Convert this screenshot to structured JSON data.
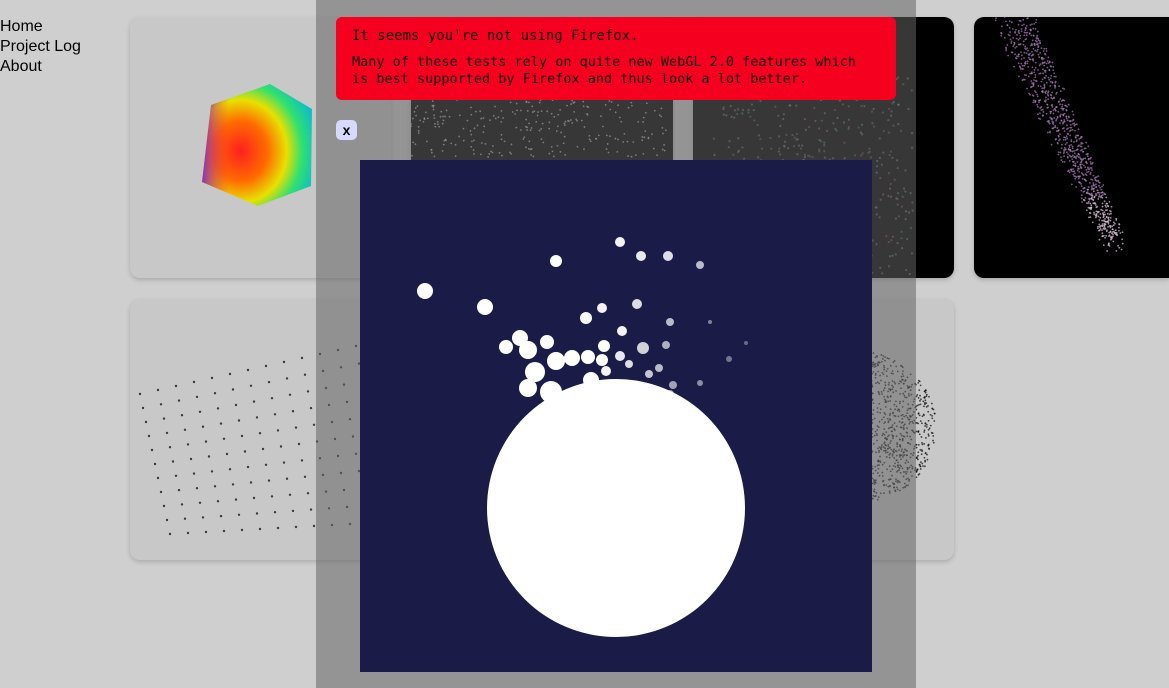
{
  "nav": {
    "items": [
      {
        "label": "Home"
      },
      {
        "label": "Project Log"
      },
      {
        "label": "About"
      }
    ]
  },
  "notice": {
    "title": "It seems you're not using Firefox.",
    "body": "Many of these tests rely on quite new WebGL 2.0 features which is best supported by Firefox and thus look a lot better."
  },
  "close_button": {
    "label": "x"
  },
  "colors": {
    "page_bg": "#cfcfcf",
    "notice_bg": "#f5001f",
    "close_bg": "#d7d9ff",
    "demo_bg": "#1a1b47"
  }
}
